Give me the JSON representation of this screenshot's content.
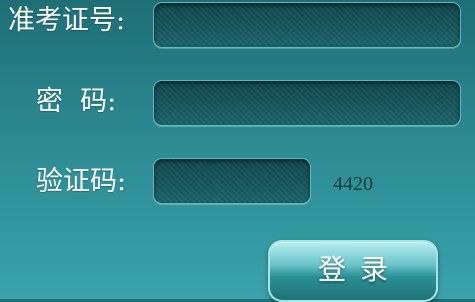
{
  "form": {
    "exam_id_label": "准考证号:",
    "password_label": "密  码:",
    "captcha_label": "验证码:",
    "exam_id_value": "",
    "password_value": "",
    "captcha_value": "",
    "captcha_code": "4420",
    "login_label": "登录"
  },
  "colors": {
    "background": "#2c8991",
    "field": "#14545a",
    "button": "#67c3c8",
    "text": "#ffffff"
  }
}
